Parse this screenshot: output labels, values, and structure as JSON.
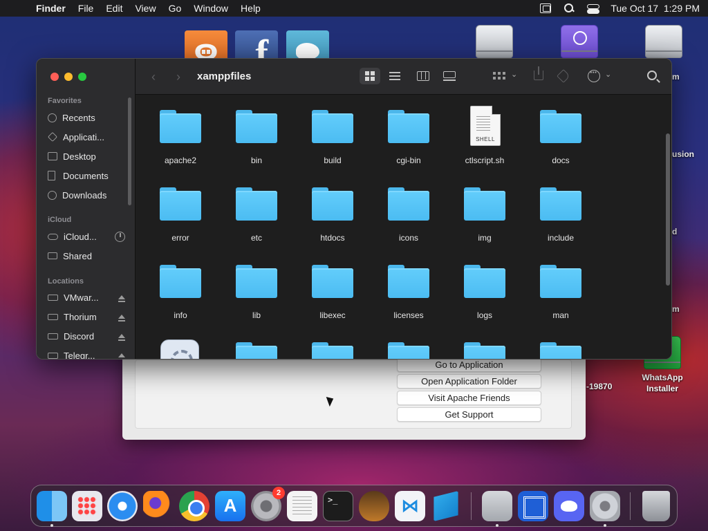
{
  "menubar": {
    "app_name": "Finder",
    "items": [
      "File",
      "Edit",
      "View",
      "Go",
      "Window",
      "Help"
    ],
    "datetime": "Tue Oct 17  1:29 PM"
  },
  "desktop": {
    "icons": [
      {
        "label": ""
      },
      {
        "label": ""
      },
      {
        "label": ""
      },
      {
        "label": "WhatsApp Installer"
      }
    ],
    "clipped_labels": [
      "m",
      "usion",
      "d",
      "m",
      "-19870"
    ]
  },
  "xampp": {
    "badges": {
      "xampp": "ꙫ",
      "facebook": "f"
    },
    "buttons": [
      "Go to Application",
      "Open Application Folder",
      "Visit Apache Friends",
      "Get Support"
    ]
  },
  "finder": {
    "title": "xamppfiles",
    "sidebar": {
      "favorites_header": "Favorites",
      "favorites": [
        "Recents",
        "Applicati...",
        "Desktop",
        "Documents",
        "Downloads"
      ],
      "icloud_header": "iCloud",
      "icloud": [
        "iCloud...",
        "Shared"
      ],
      "locations_header": "Locations",
      "locations": [
        "VMwar...",
        "Thorium",
        "Discord",
        "Telegr..."
      ]
    },
    "items": [
      {
        "name": "apache2",
        "kind": "folder"
      },
      {
        "name": "bin",
        "kind": "folder"
      },
      {
        "name": "build",
        "kind": "folder"
      },
      {
        "name": "cgi-bin",
        "kind": "folder"
      },
      {
        "name": "ctlscript.sh",
        "kind": "shell"
      },
      {
        "name": "docs",
        "kind": "folder"
      },
      {
        "name": "error",
        "kind": "folder"
      },
      {
        "name": "etc",
        "kind": "folder"
      },
      {
        "name": "htdocs",
        "kind": "folder"
      },
      {
        "name": "icons",
        "kind": "folder"
      },
      {
        "name": "img",
        "kind": "folder"
      },
      {
        "name": "include",
        "kind": "folder"
      },
      {
        "name": "info",
        "kind": "folder"
      },
      {
        "name": "lib",
        "kind": "folder"
      },
      {
        "name": "libexec",
        "kind": "folder"
      },
      {
        "name": "licenses",
        "kind": "folder"
      },
      {
        "name": "logs",
        "kind": "folder"
      },
      {
        "name": "man",
        "kind": "folder"
      },
      {
        "name": "",
        "kind": "app"
      },
      {
        "name": "",
        "kind": "folder"
      },
      {
        "name": "",
        "kind": "folder"
      },
      {
        "name": "",
        "kind": "folder"
      },
      {
        "name": "",
        "kind": "folder"
      },
      {
        "name": "",
        "kind": "folder"
      }
    ],
    "shell_tag": "SHELL"
  },
  "dock": {
    "settings_badge": "2",
    "appstore_glyph": "A",
    "terminal_glyph": ">_",
    "vscode_glyph": "⋈"
  },
  "colors": {
    "folder": "#4bbcf2",
    "accent_red": "#ff5f57",
    "accent_yellow": "#febc2e",
    "accent_green": "#28c840"
  }
}
